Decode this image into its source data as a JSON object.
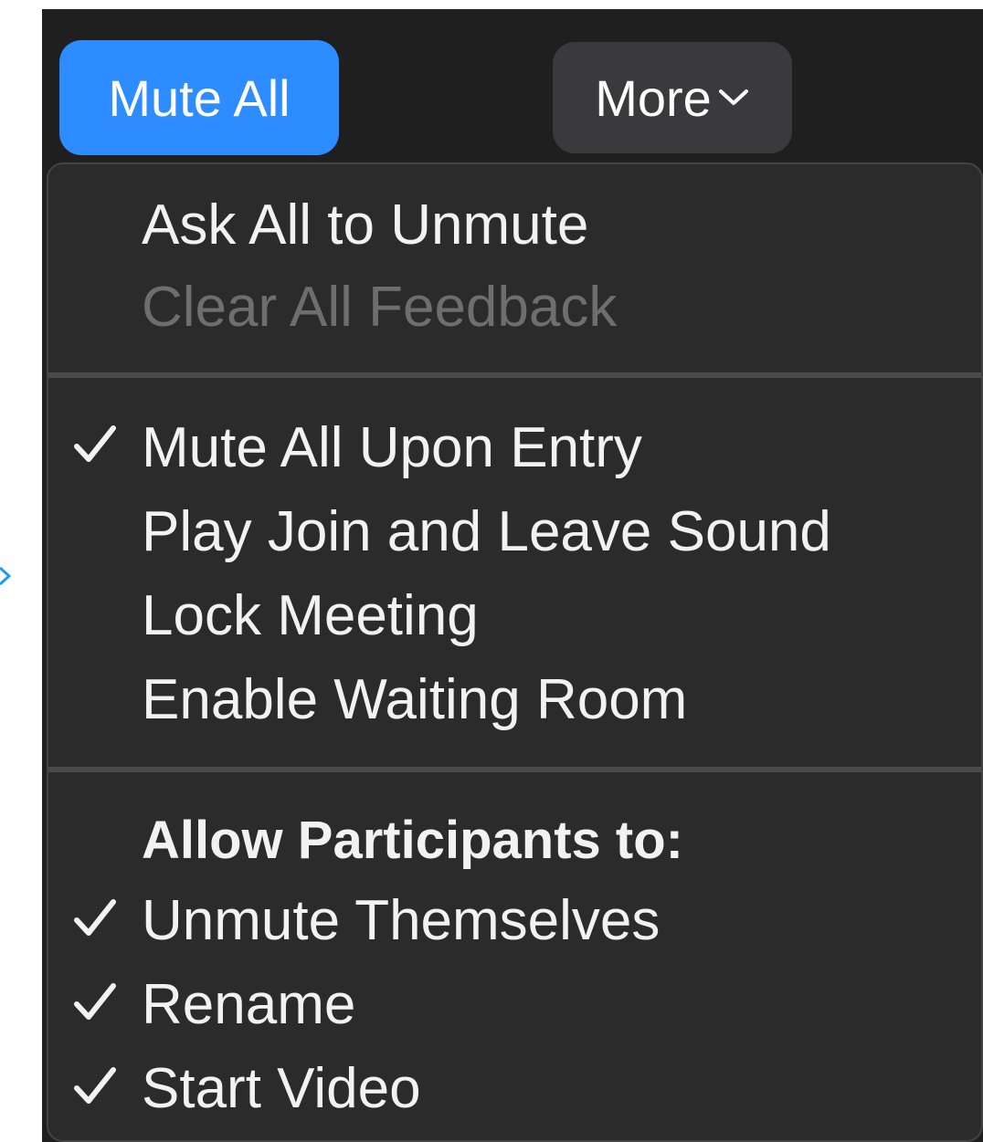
{
  "toolbar": {
    "mute_all_label": "Mute All",
    "more_label": "More"
  },
  "colors": {
    "accent_blue": "#2d8cff",
    "menu_bg": "#2b2b2b",
    "disabled_text": "#6e6e6e"
  },
  "menu": {
    "group1": {
      "ask_unmute": "Ask All to Unmute",
      "clear_feedback": "Clear All Feedback"
    },
    "group2": {
      "mute_upon_entry": {
        "label": "Mute All Upon Entry",
        "checked": true
      },
      "join_leave_sound": {
        "label": "Play Join and Leave Sound",
        "checked": false
      },
      "lock_meeting": {
        "label": "Lock Meeting",
        "checked": false
      },
      "waiting_room": {
        "label": "Enable Waiting Room",
        "checked": false
      }
    },
    "group3": {
      "header": "Allow Participants to:",
      "unmute_themselves": {
        "label": "Unmute Themselves",
        "checked": true
      },
      "rename": {
        "label": "Rename",
        "checked": true
      },
      "start_video": {
        "label": "Start Video",
        "checked": true
      }
    }
  },
  "icons": {
    "check": "checkmark-icon",
    "chevron": "chevron-down-icon"
  }
}
